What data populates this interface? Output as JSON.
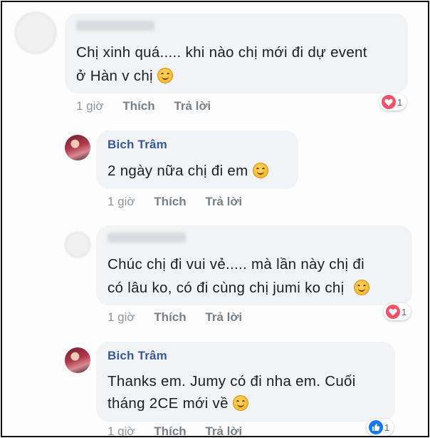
{
  "comments": [
    {
      "name": "",
      "text_lines": [
        "Chị xinh quá..... khi nào chị mới đi dự event",
        "ở Hàn v chị"
      ],
      "time": "1 giờ",
      "like": "Thích",
      "reply": "Trả lời",
      "reaction": {
        "type": "heart",
        "count": "1"
      }
    },
    {
      "name": "Bich Trâm",
      "text_lines": [
        "2 ngày nữa chị đi em"
      ],
      "time": "1 giờ",
      "like": "Thích",
      "reply": "Trả lời"
    },
    {
      "name": "",
      "text_lines": [
        "Chúc chị đi vui vẻ..... mà lần này chị đi",
        "có lâu ko, có đi cùng chị jumi ko chị"
      ],
      "time": "1 giờ",
      "like": "Thích",
      "reply": "Trả lời",
      "reaction": {
        "type": "heart",
        "count": "1"
      }
    },
    {
      "name": "Bich Trâm",
      "text_lines": [
        "Thanks em. Jumy có đi nha em. Cuối",
        "tháng 2CE mới về"
      ],
      "time": "1 giờ",
      "like": "Thích",
      "reply": "Trả lời",
      "reaction": {
        "type": "like",
        "count": "1"
      }
    }
  ],
  "colors": {
    "name": "#385898",
    "bubble": "#f2f3f5",
    "heart": "#f25268",
    "like": "#1877f2"
  }
}
